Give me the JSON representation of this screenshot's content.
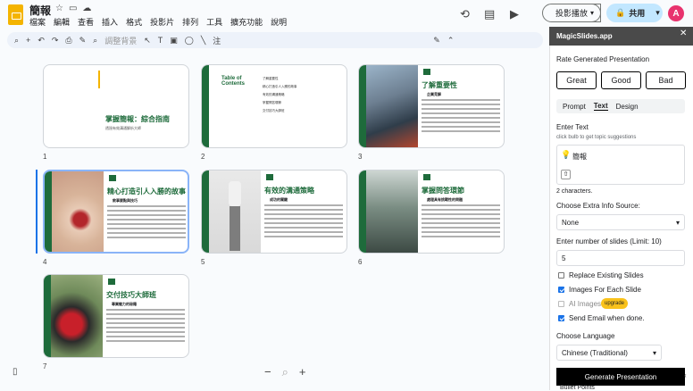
{
  "app": {
    "doc_title": "簡報",
    "menu": [
      "檔案",
      "編輯",
      "查看",
      "插入",
      "格式",
      "投影片",
      "排列",
      "工具",
      "擴充功能",
      "說明"
    ],
    "present_label": "投影播放",
    "share_label": "共用",
    "avatar_letter": "A"
  },
  "toolbar": {
    "background_label": "調整背景",
    "notes_label": "注"
  },
  "slides": [
    {
      "num": "1",
      "title": "掌握簡報：綜合指南",
      "subtitle": "透過有效溝通解析大師"
    },
    {
      "num": "2",
      "title": "Table of Contents",
      "toc": [
        "了解重要性",
        "精心打造引人入勝的故事",
        "有效的溝通策略",
        "掌握問答環節",
        "交付技巧大師班"
      ]
    },
    {
      "num": "3",
      "title": "了解重要性",
      "head": "企業見解"
    },
    {
      "num": "4",
      "title": "精心打造引人入勝的故事",
      "head": "敘事要點與技巧"
    },
    {
      "num": "5",
      "title": "有效的溝通策略",
      "head": "成功的關鍵"
    },
    {
      "num": "6",
      "title": "掌握問答環節",
      "head": "處理具有挑戰性的問題"
    },
    {
      "num": "7",
      "title": "交付技巧大師班",
      "head": "專業魅力的秘籍"
    }
  ],
  "panel": {
    "title": "MagicSlides.app",
    "rate_label": "Rate Generated Presentation",
    "rate_buttons": [
      "Great",
      "Good",
      "Bad"
    ],
    "tabs": [
      "Prompt",
      "Text",
      "Design"
    ],
    "enter_text": "Enter Text",
    "hint": "click bulb to get topic suggestions",
    "text_value": "簡報",
    "char_count": "2 characters.",
    "extra_label": "Choose Extra Info Source:",
    "extra_value": "None",
    "slides_label": "Enter number of slides (Limit: 10)",
    "slides_value": "5",
    "opt_replace": "Replace Existing Slides",
    "opt_images": "Images For Each Slide",
    "opt_ai": "AI Images",
    "upgrade": "upgrade",
    "opt_email": "Send Email when done.",
    "lang_label": "Choose Language",
    "lang_value": "Chinese (Traditional)",
    "generate": "Generate Presentation",
    "below": "Bullet Points"
  }
}
